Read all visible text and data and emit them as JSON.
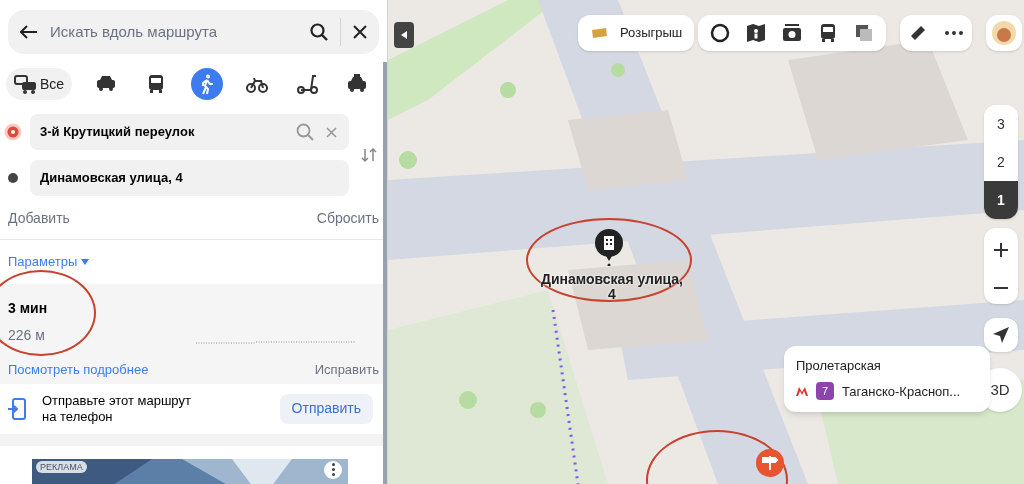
{
  "search": {
    "placeholder": "Искать вдоль маршрута"
  },
  "modes": [
    {
      "kind": "all",
      "label": "Все",
      "selected": false
    },
    {
      "kind": "car",
      "selected": false
    },
    {
      "kind": "bus",
      "selected": false
    },
    {
      "kind": "walk",
      "selected": true
    },
    {
      "kind": "bike",
      "selected": false
    },
    {
      "kind": "scooter",
      "selected": false
    },
    {
      "kind": "taxi",
      "selected": false
    }
  ],
  "route_points": [
    {
      "kind": "start",
      "value": "3-й Крутицкий переулок"
    },
    {
      "kind": "end",
      "value": "Динамовская улица, 4"
    }
  ],
  "add_label": "Добавить",
  "reset_label": "Сбросить",
  "params_label": "Параметры",
  "route": {
    "time": "3 мин",
    "distance": "226 м",
    "details_link": "Посмотреть подробнее",
    "fix_link": "Исправить"
  },
  "send_to_phone": {
    "text": "Отправьте этот маршрут на телефон",
    "button": "Отправить"
  },
  "ad": {
    "badge": "РЕКЛАМА"
  },
  "map": {
    "raffle_button": "Розыгрыш",
    "floors": [
      {
        "label": "3",
        "selected": false
      },
      {
        "label": "2",
        "selected": false
      },
      {
        "label": "1",
        "selected": true
      }
    ],
    "pin_label": "Динамовская улица, 4",
    "compass_label": "3D",
    "metro_popup": {
      "station": "Пролетарская",
      "line_number": "7",
      "line_name": "Таганско-Красноп..."
    }
  }
}
